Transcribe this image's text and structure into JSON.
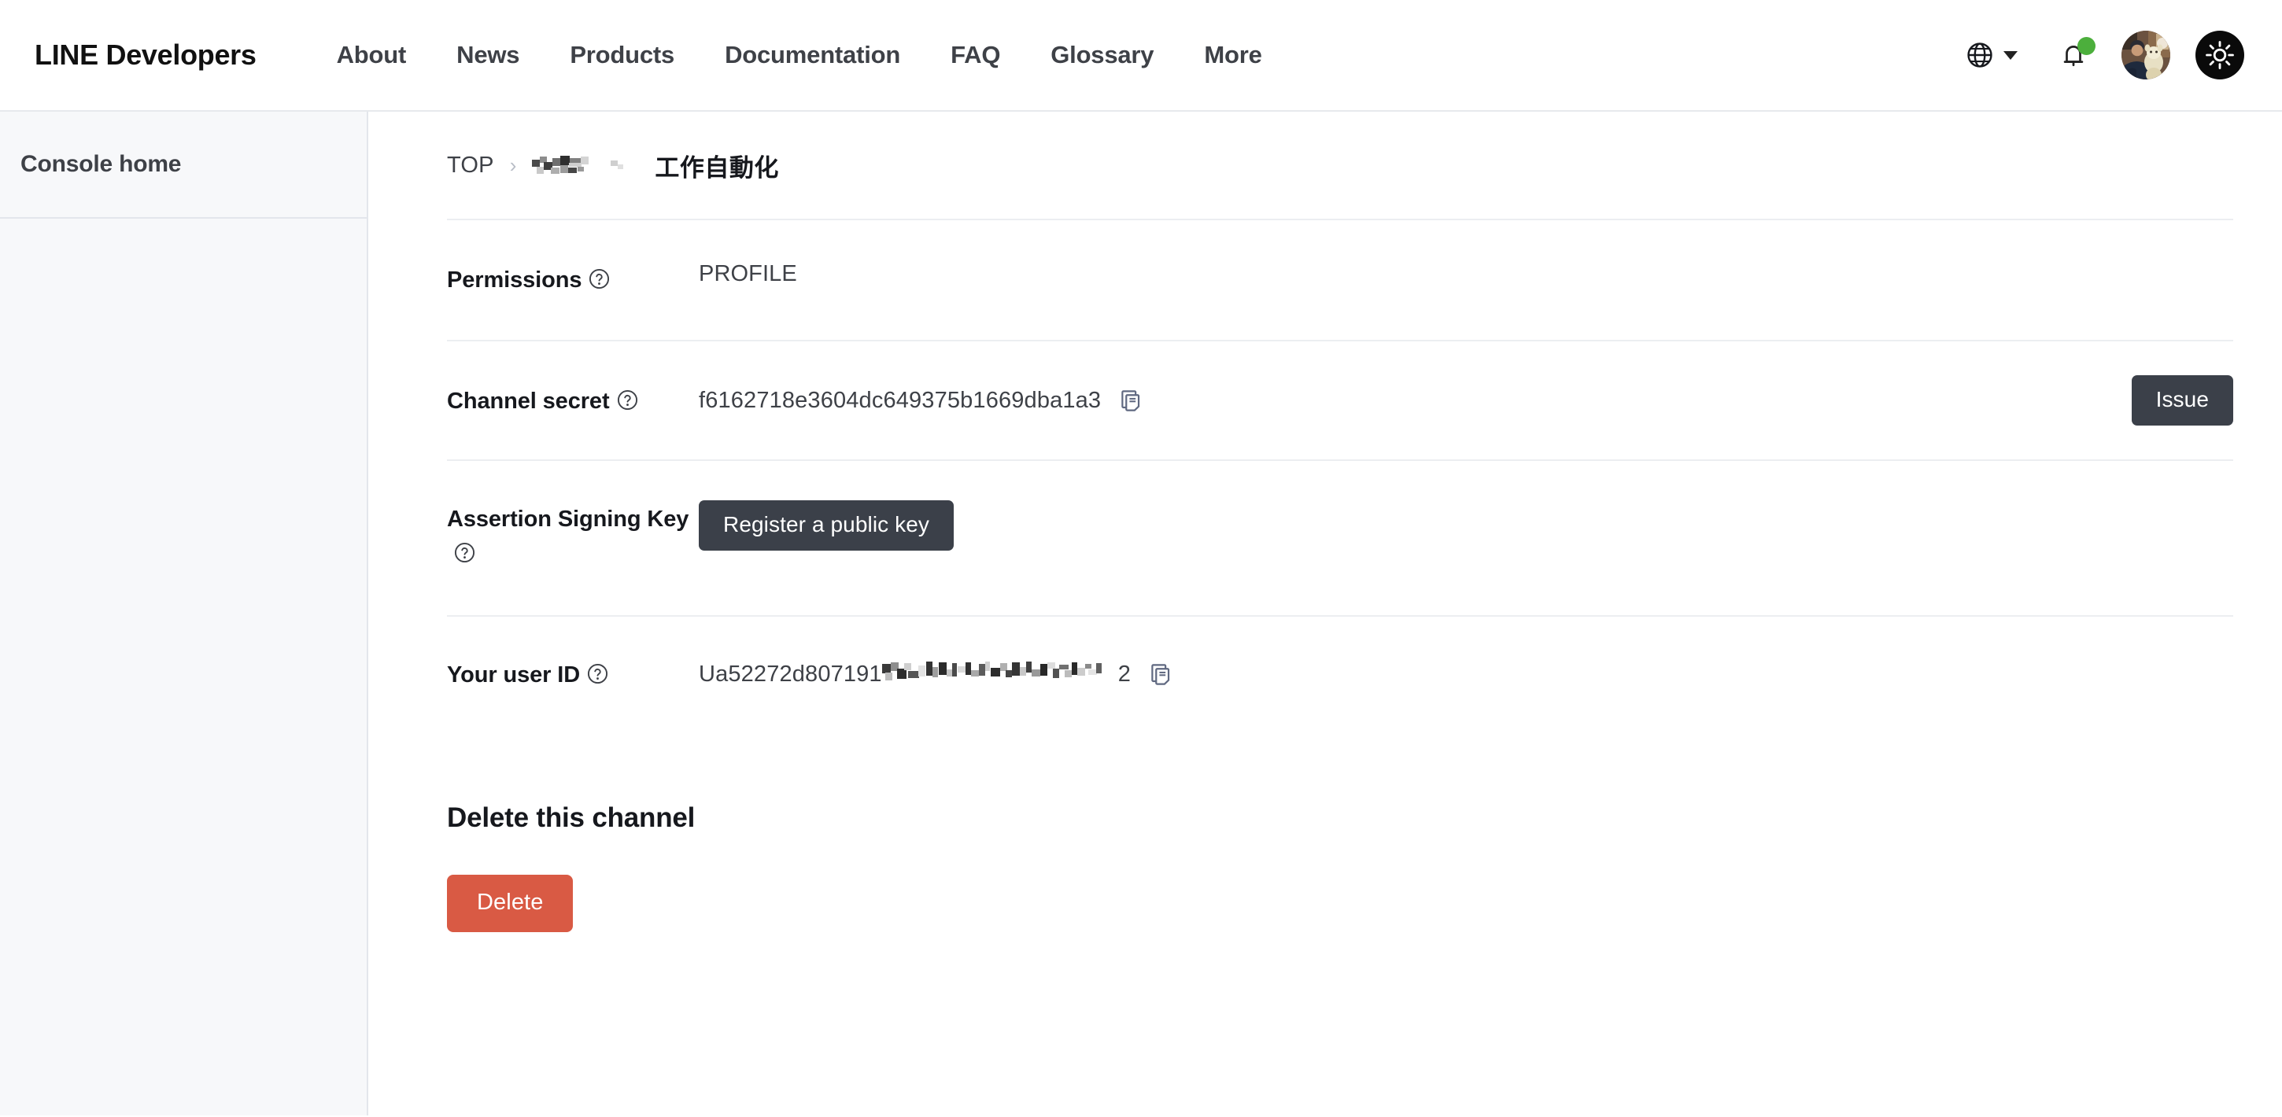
{
  "header": {
    "brand": "LINE Developers",
    "nav": [
      {
        "label": "About"
      },
      {
        "label": "News"
      },
      {
        "label": "Products"
      },
      {
        "label": "Documentation"
      },
      {
        "label": "FAQ"
      },
      {
        "label": "Glossary"
      },
      {
        "label": "More"
      }
    ],
    "icons": {
      "language": "globe-icon",
      "language_caret": "chevron-down-icon",
      "notifications": "bell-icon",
      "notification_badge_color": "#4caf3c",
      "avatar": "user-avatar",
      "theme_toggle": "sun-icon",
      "theme_toggle_bg": "#0a0a0a"
    }
  },
  "sidebar": {
    "items": [
      {
        "label": "Console home"
      }
    ]
  },
  "breadcrumb": {
    "top": "TOP",
    "separator": "›",
    "redacted_provider": "",
    "current": "工作自動化"
  },
  "fields": {
    "permissions": {
      "label": "Permissions",
      "help": "help-icon",
      "value": "PROFILE"
    },
    "channel_secret": {
      "label": "Channel secret",
      "help": "help-icon",
      "value": "f6162718e3604dc649375b1669dba1a3",
      "copy": "copy-icon",
      "action_label": "Issue"
    },
    "assertion_signing_key": {
      "label": "Assertion Signing Key",
      "help": "help-icon",
      "action_label": "Register a public key"
    },
    "your_user_id": {
      "label": "Your user ID",
      "help": "help-icon",
      "value_prefix": "Ua52272d807191",
      "value_suffix": "2",
      "copy": "copy-icon"
    }
  },
  "delete_section": {
    "title": "Delete this channel",
    "button_label": "Delete",
    "button_color": "#d95a44"
  },
  "colors": {
    "text_primary": "#16181d",
    "text_secondary": "#3e4147",
    "divider": "#eceef1",
    "sidebar_bg": "#f7f8fa",
    "button_dark": "#3b4049",
    "danger": "#d95a44",
    "badge_green": "#4caf3c"
  }
}
